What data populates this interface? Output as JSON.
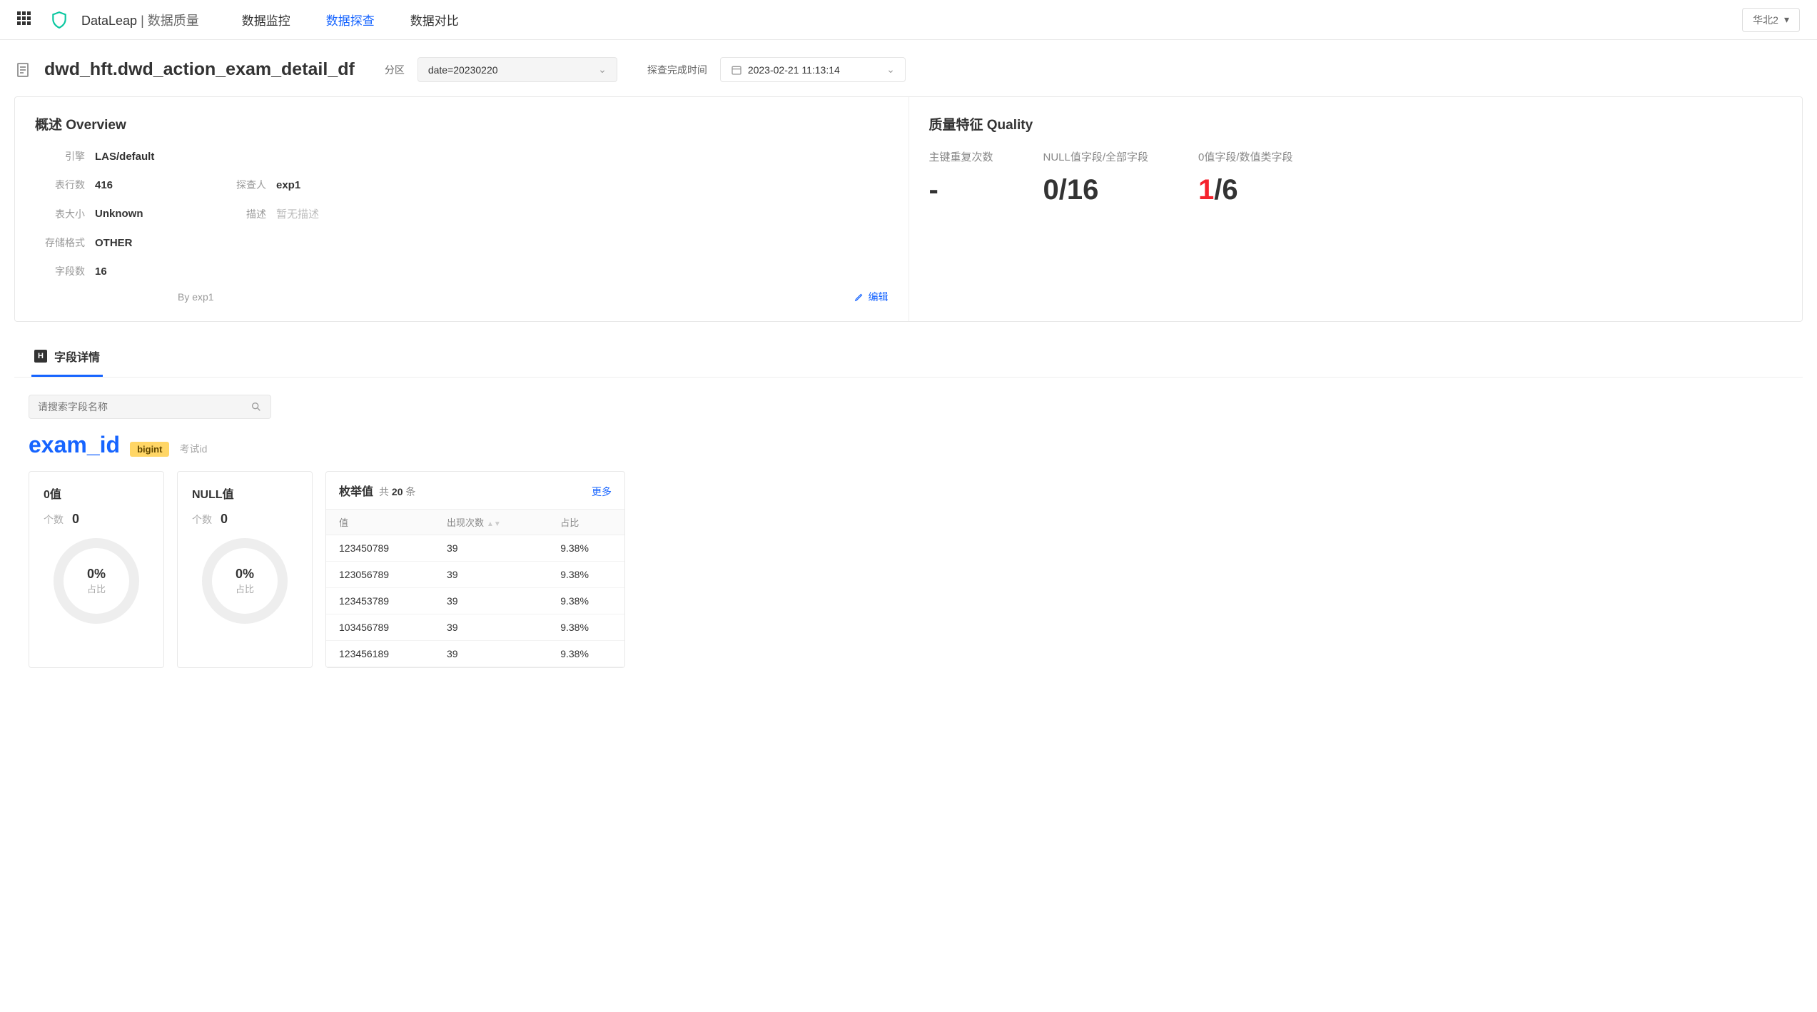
{
  "topbar": {
    "brand_prefix": "DataLeap",
    "brand_sep": " | ",
    "brand_suffix": "数据质量",
    "navs": [
      "数据监控",
      "数据探查",
      "数据对比"
    ],
    "active_nav": 1,
    "region": "华北2"
  },
  "header": {
    "title": "dwd_hft.dwd_action_exam_detail_df",
    "partition_label": "分区",
    "partition_value": "date=20230220",
    "time_label": "探查完成时间",
    "time_value": "2023-02-21 11:13:14"
  },
  "overview": {
    "title": "概述 Overview",
    "rows": {
      "engine_label": "引擎",
      "engine": "LAS/default",
      "rows_label": "表行数",
      "rows": "416",
      "owner_label": "探查人",
      "owner": "exp1",
      "size_label": "表大小",
      "size": "Unknown",
      "desc_label": "描述",
      "desc_placeholder": "暂无描述",
      "fmt_label": "存储格式",
      "fmt": "OTHER",
      "cols_label": "字段数",
      "cols": "16"
    },
    "by": "By exp1",
    "edit": "编辑"
  },
  "quality": {
    "title": "质量特征 Quality",
    "pk_label": "主键重复次数",
    "pk_value": "-",
    "null_label": "NULL值字段/全部字段",
    "null_value": "0/16",
    "zero_label": "0值字段/数值类字段",
    "zero_red": "1",
    "zero_rest": "/6"
  },
  "tabs": {
    "field_detail": "字段详情"
  },
  "search": {
    "placeholder": "请搜索字段名称"
  },
  "field": {
    "name": "exam_id",
    "type": "bigint",
    "desc": "考试id"
  },
  "cards": {
    "zero_title": "0值",
    "null_title": "NULL值",
    "count_label": "个数",
    "zero_count": "0",
    "null_count": "0",
    "zero_pct": "0%",
    "null_pct": "0%",
    "pct_sub": "占比"
  },
  "enum": {
    "title": "枚举值",
    "sub_prefix": "共 ",
    "sub_count": "20",
    "sub_suffix": " 条",
    "more": "更多",
    "cols": {
      "value": "值",
      "count": "出现次数",
      "ratio": "占比"
    },
    "rows": [
      {
        "v": "123450789",
        "c": "39",
        "r": "9.38%"
      },
      {
        "v": "123056789",
        "c": "39",
        "r": "9.38%"
      },
      {
        "v": "123453789",
        "c": "39",
        "r": "9.38%"
      },
      {
        "v": "103456789",
        "c": "39",
        "r": "9.38%"
      },
      {
        "v": "123456189",
        "c": "39",
        "r": "9.38%"
      }
    ]
  }
}
